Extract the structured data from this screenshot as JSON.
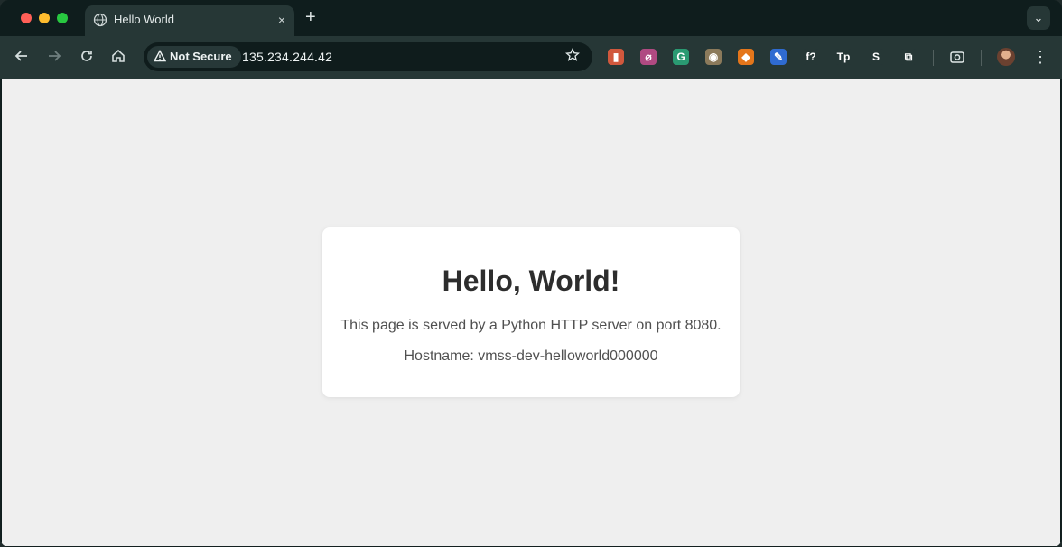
{
  "browser": {
    "tab": {
      "title": "Hello World",
      "close_glyph": "×"
    },
    "new_tab_glyph": "+",
    "tab_menu_glyph": "⌄",
    "security_chip": "Not Secure",
    "url": "135.234.244.42",
    "icons": {
      "back": "arrow-left-icon",
      "forward": "arrow-right-icon",
      "reload": "reload-icon",
      "home": "home-icon",
      "bookmark": "star-icon"
    },
    "extensions": [
      {
        "name": "ext-red-icon",
        "glyph": "▮",
        "color": "#d1583d"
      },
      {
        "name": "ext-compass-icon",
        "glyph": "⌀",
        "color": "#b04a82"
      },
      {
        "name": "grammarly-icon",
        "glyph": "G",
        "color": "#2a9a72"
      },
      {
        "name": "ext-glasses-icon",
        "glyph": "◉",
        "color": "#8b7a5b"
      },
      {
        "name": "metamask-icon",
        "glyph": "◆",
        "color": "#e4761b"
      },
      {
        "name": "ext-pen-icon",
        "glyph": "✎",
        "color": "#2f6bd1"
      },
      {
        "name": "ext-fx-icon",
        "glyph": "f?",
        "color": "#263736"
      },
      {
        "name": "ext-tp-icon",
        "glyph": "Tp",
        "color": "#263736"
      },
      {
        "name": "ext-s-icon",
        "glyph": "S",
        "color": "#263736"
      },
      {
        "name": "extensions-puzzle-icon",
        "glyph": "⧉",
        "color": "#263736"
      }
    ],
    "screen_capture_icon": "camera-icon",
    "menu_glyph": "⋮"
  },
  "page": {
    "heading": "Hello, World!",
    "line1": "This page is served by a Python HTTP server on port 8080.",
    "line2": "Hostname: vmss-dev-helloworld000000"
  },
  "colors": {
    "page_bg": "#efefef",
    "card_bg": "#ffffff",
    "toolbar_bg": "#263736"
  }
}
